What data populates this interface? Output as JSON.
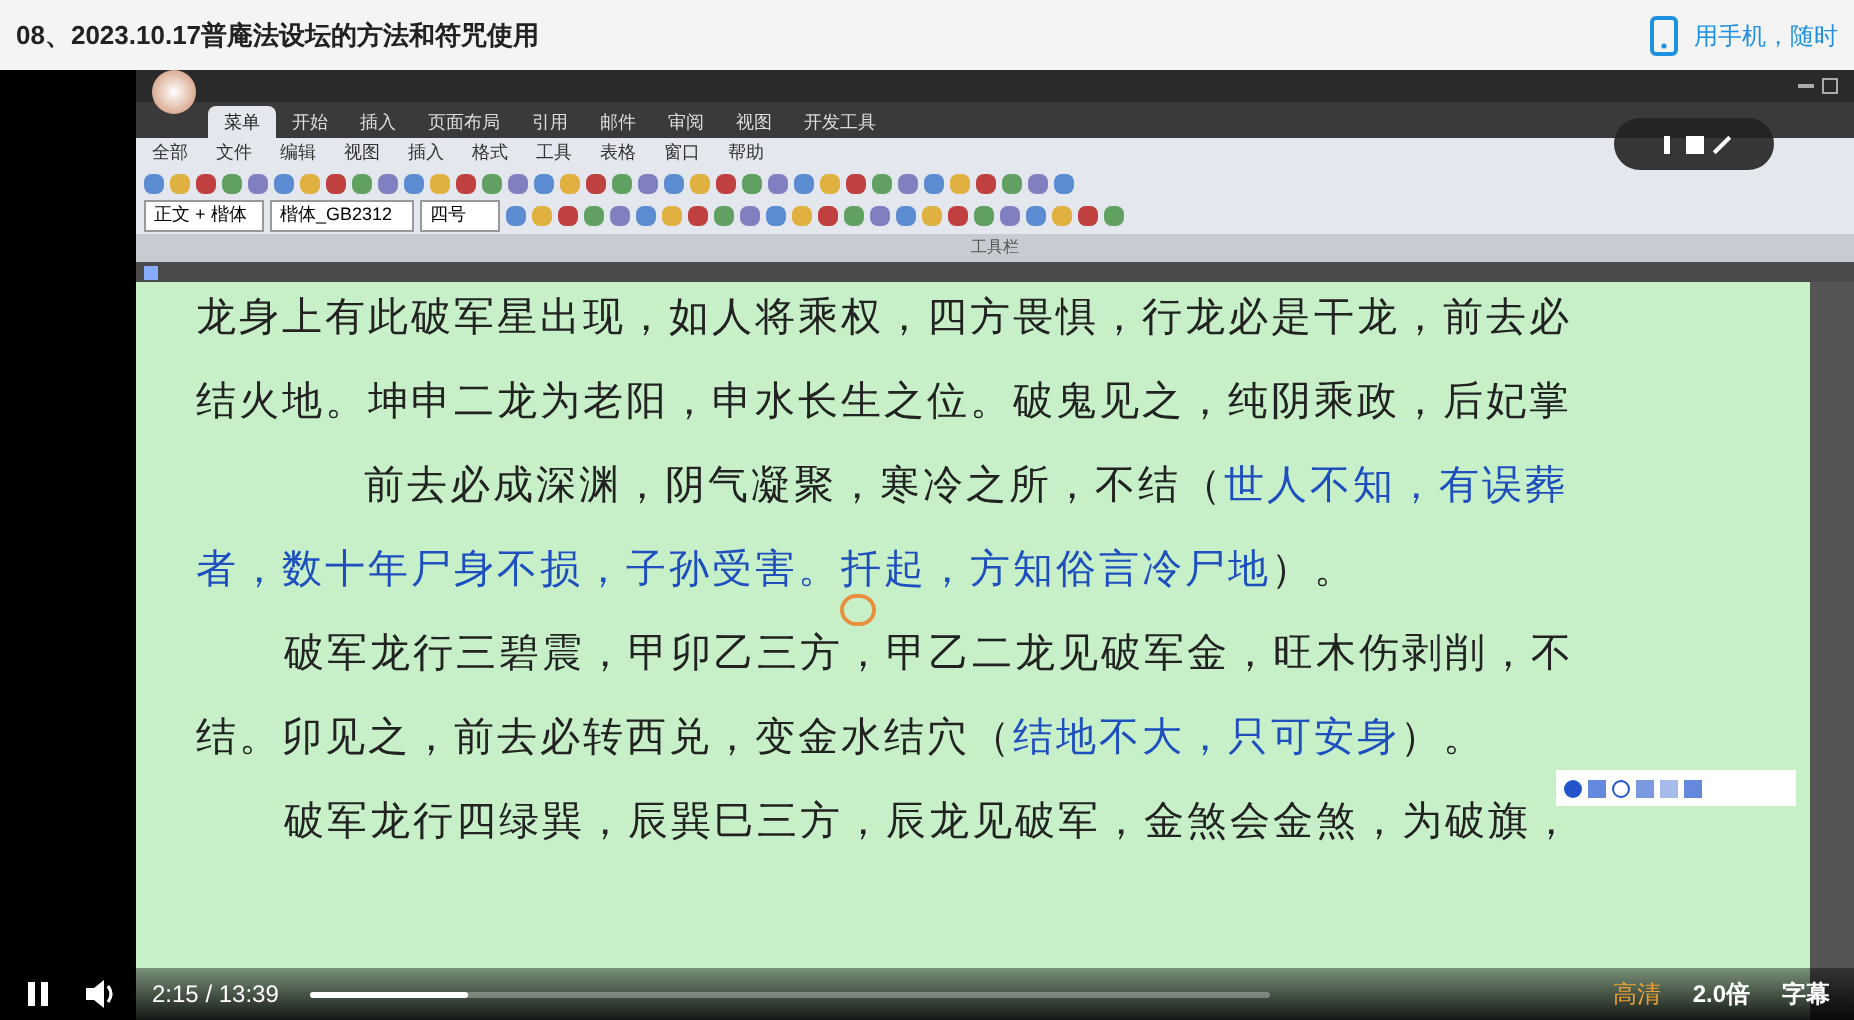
{
  "header": {
    "title": "08、2023.10.17普庵法设坛的方法和符咒使用",
    "mobile_link": "用手机，随时"
  },
  "word": {
    "tabs": [
      {
        "label": "菜单",
        "selected": true
      },
      {
        "label": "开始",
        "selected": false
      },
      {
        "label": "插入",
        "selected": false
      },
      {
        "label": "页面布局",
        "selected": false
      },
      {
        "label": "引用",
        "selected": false
      },
      {
        "label": "邮件",
        "selected": false
      },
      {
        "label": "审阅",
        "selected": false
      },
      {
        "label": "视图",
        "selected": false
      },
      {
        "label": "开发工具",
        "selected": false
      }
    ],
    "menu": [
      "全部",
      "文件",
      "编辑",
      "视图",
      "插入",
      "格式",
      "工具",
      "表格",
      "窗口",
      "帮助"
    ],
    "style_box": "正文 + 楷体",
    "font_box": "楷体_GB2312",
    "size_box": "四号",
    "toolbar_caption": "工具栏",
    "lines": [
      {
        "indent": false,
        "segments": [
          {
            "kind": "body",
            "text": "龙身上有此破军星出现，如人将乘权，四方畏惧，行龙必是干龙，前去必"
          }
        ]
      },
      {
        "indent": false,
        "segments": [
          {
            "kind": "body",
            "text": "结火地。坤申二龙为老阳，申水长生之位。破鬼见之，纯阴乘政，后妃掌"
          }
        ]
      },
      {
        "indent": true,
        "segments": [
          {
            "kind": "body",
            "text": "前去必成深渊，阴气凝聚，寒冷之所，不结（"
          },
          {
            "kind": "note",
            "text": "世人不知，有误葬"
          }
        ]
      },
      {
        "indent": false,
        "segments": [
          {
            "kind": "note",
            "text": "者，数十年尸身不损，子孙受害。扦起，方知俗言冷尸地"
          },
          {
            "kind": "body",
            "text": "）。"
          }
        ]
      },
      {
        "indent": true,
        "segments": [
          {
            "kind": "body",
            "text": "破军龙行三碧震，甲卯乙三方，甲乙二龙见破军金，旺木伤剥削，不"
          }
        ]
      },
      {
        "indent": false,
        "segments": [
          {
            "kind": "body",
            "text": "结。卯见之，前去必转西兑，变金水结穴（"
          },
          {
            "kind": "note",
            "text": "结地不大，只可安身"
          },
          {
            "kind": "body",
            "text": "）。"
          }
        ]
      },
      {
        "indent": true,
        "segments": [
          {
            "kind": "body",
            "text": "破军龙行四绿巽，辰巽巳三方，辰龙见破军，金煞会金煞，为破旗，"
          }
        ]
      }
    ]
  },
  "player": {
    "playing": true,
    "time": "2:15 / 13:39",
    "level": 0.164,
    "quality": "高清",
    "speed": "2.0倍",
    "subtitles": "字幕"
  }
}
